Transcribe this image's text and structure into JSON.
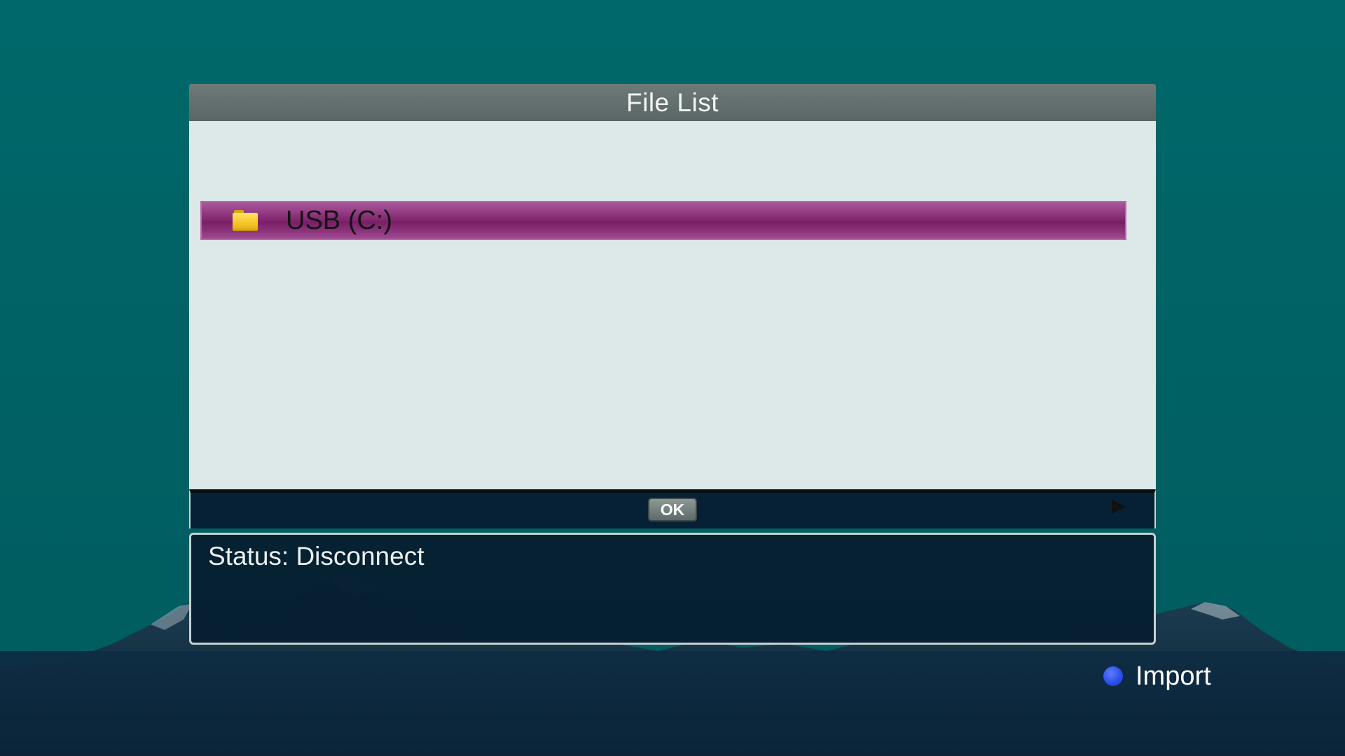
{
  "dialog": {
    "title": "File List",
    "items": [
      {
        "label": "USB (C:)",
        "icon": "folder-icon",
        "selected": true
      }
    ],
    "ok_label": "OK",
    "next_icon": "play-arrow-icon"
  },
  "status": {
    "text": "Status: Disconnect"
  },
  "footer": {
    "hints": [
      {
        "color_key": "blue",
        "color": "#2a4ce8",
        "label": "Import"
      }
    ]
  },
  "colors": {
    "background": "#00686a",
    "title_bar": "#5e6a69",
    "panel": "#dde8e8",
    "selection": "#8c357c",
    "status_panel": "#051e30"
  }
}
